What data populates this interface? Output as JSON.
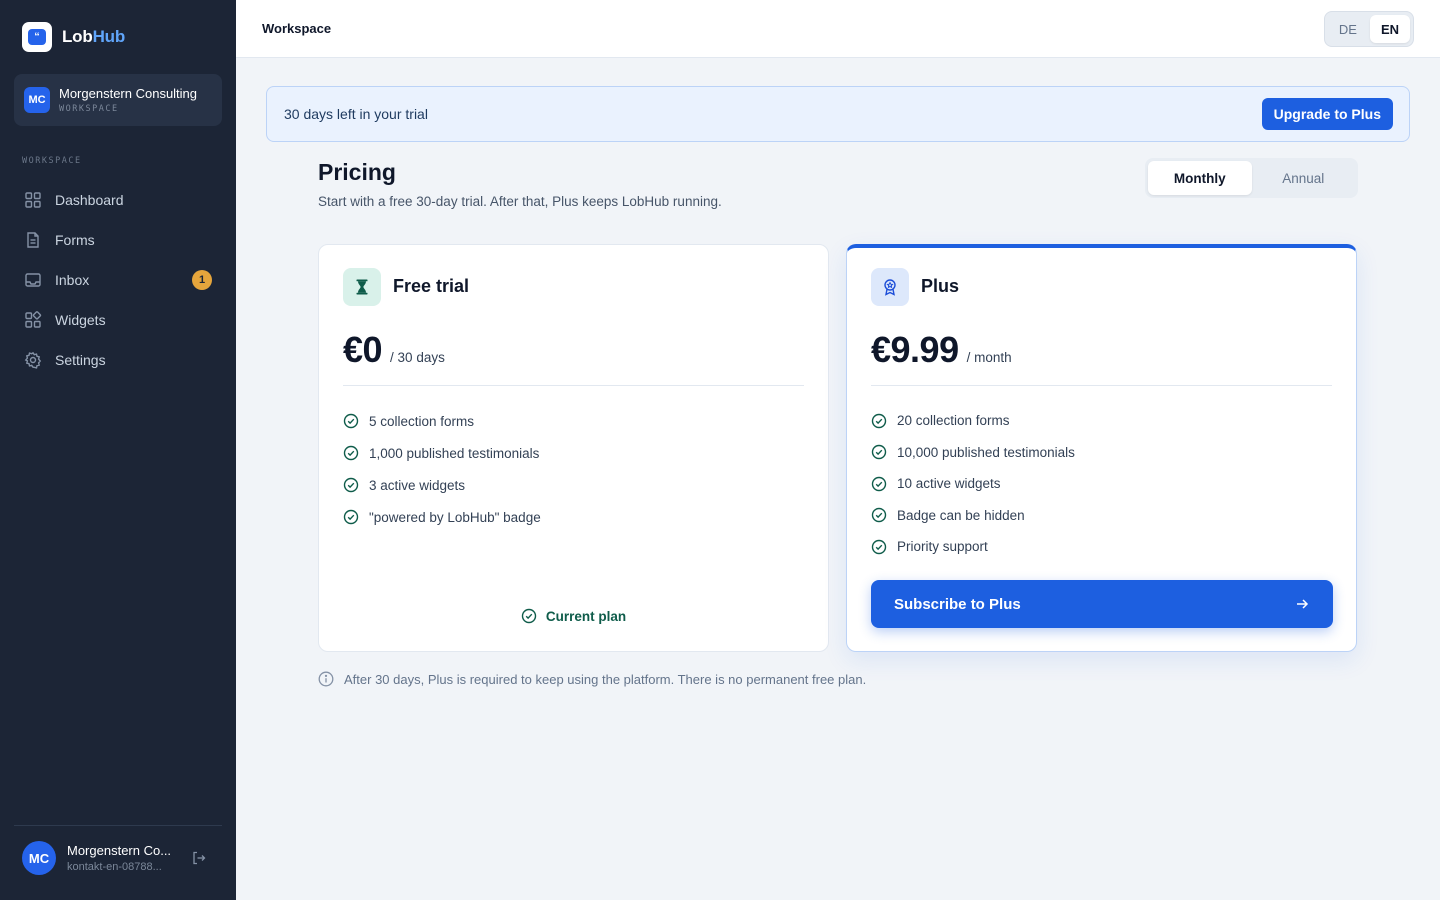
{
  "app": {
    "name_part1": "Lob",
    "name_part2": "Hub",
    "logo_glyph": "“"
  },
  "workspace": {
    "initials": "MC",
    "name": "Morgenstern Consulting",
    "label": "WORKSPACE"
  },
  "sidebar": {
    "section_label": "WORKSPACE",
    "items": [
      {
        "label": "Dashboard",
        "icon": "dashboard-icon"
      },
      {
        "label": "Forms",
        "icon": "document-icon"
      },
      {
        "label": "Inbox",
        "icon": "inbox-icon",
        "badge": "1"
      },
      {
        "label": "Widgets",
        "icon": "widgets-icon"
      },
      {
        "label": "Settings",
        "icon": "gear-icon"
      }
    ]
  },
  "user": {
    "initials": "MC",
    "name": "Morgenstern Co...",
    "email": "kontakt-en-08788..."
  },
  "topbar": {
    "title": "Workspace",
    "languages": [
      "DE",
      "EN"
    ],
    "active_language": "EN"
  },
  "banner": {
    "text": "30 days left in your trial",
    "button": "Upgrade to Plus"
  },
  "pricing": {
    "title": "Pricing",
    "subtitle": "Start with a free 30-day trial. After that, Plus keeps LobHub running.",
    "billing_options": [
      "Monthly",
      "Annual"
    ],
    "active_billing": "Monthly"
  },
  "plans": {
    "free": {
      "name": "Free trial",
      "price": "€0",
      "period": "/ 30 days",
      "features": [
        "5 collection forms",
        "1,000 published testimonials",
        "3 active widgets",
        "\"powered by LobHub\" badge"
      ],
      "status": "Current plan"
    },
    "plus": {
      "name": "Plus",
      "price": "€9.99",
      "period": "/ month",
      "features": [
        "20 collection forms",
        "10,000 published testimonials",
        "10 active widgets",
        "Badge can be hidden",
        "Priority support"
      ],
      "cta": "Subscribe to Plus"
    }
  },
  "note": "After 30 days, Plus is required to keep using the platform. There is no permanent free plan.",
  "colors": {
    "sidebar_bg": "#1c2536",
    "accent": "#1d5fe0",
    "badge": "#e5a53c",
    "success": "#0f5c4a"
  }
}
